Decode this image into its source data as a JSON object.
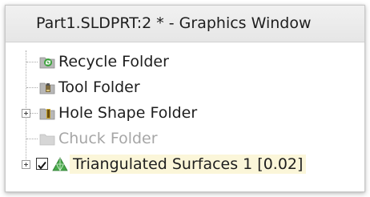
{
  "window": {
    "title": "Part1.SLDPRT:2 * - Graphics Window"
  },
  "tree": {
    "items": [
      {
        "label": "Recycle Folder",
        "icon": "recycle-folder-icon",
        "expandable": false,
        "enabled": true
      },
      {
        "label": "Tool Folder",
        "icon": "tool-folder-icon",
        "expandable": false,
        "enabled": true
      },
      {
        "label": "Hole Shape Folder",
        "icon": "hole-shape-folder-icon",
        "expandable": true,
        "enabled": true
      },
      {
        "label": "Chuck Folder",
        "icon": "chuck-folder-icon",
        "expandable": false,
        "enabled": false
      },
      {
        "label": "Triangulated Surfaces 1 [0.02]",
        "icon": "triangulated-surface-icon",
        "expandable": true,
        "enabled": true,
        "checked": true,
        "highlighted": true
      }
    ]
  },
  "colors": {
    "highlight_background": "#fbf6d9",
    "disabled_text": "#a6a6a6",
    "tree_line": "#a8a8a8"
  }
}
